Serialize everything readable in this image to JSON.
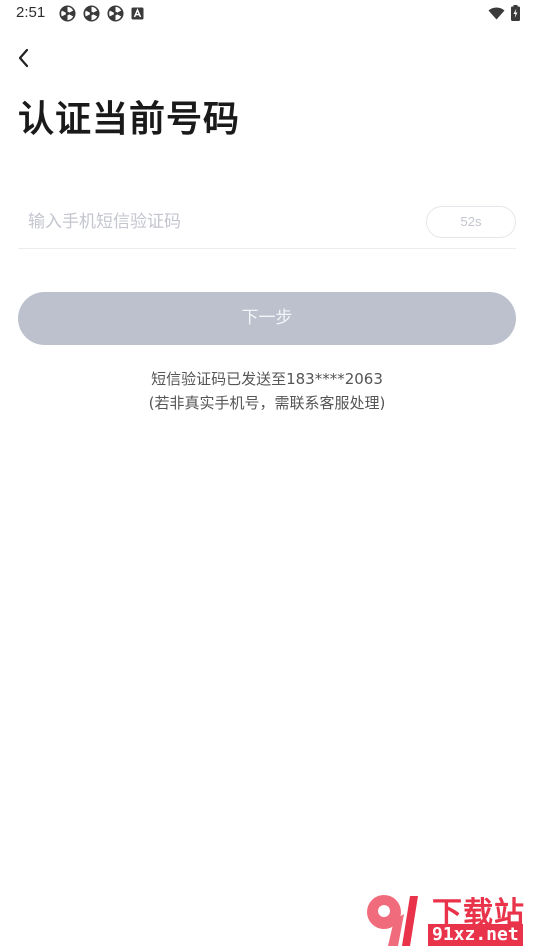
{
  "status_bar": {
    "time": "2:51",
    "left_icons": [
      "fan-icon",
      "fan-icon",
      "fan-icon",
      "a-badge-icon"
    ],
    "right_icons": [
      "wifi-icon",
      "battery-charging-icon"
    ]
  },
  "header": {
    "back_icon": "chevron-left-icon",
    "title": "认证当前号码"
  },
  "form": {
    "code_placeholder": "输入手机短信验证码",
    "code_value": "",
    "countdown": "52s",
    "next_label": "下一步"
  },
  "hint": {
    "line1": "短信验证码已发送至183****2063",
    "line2": "(若非真实手机号，需联系客服处理)"
  },
  "watermark": {
    "title": "下载站",
    "url": "91xz.net"
  },
  "colors": {
    "button_disabled": "#bcc1cd",
    "placeholder": "#c4c6cf",
    "brand_red": "#e8334a"
  }
}
